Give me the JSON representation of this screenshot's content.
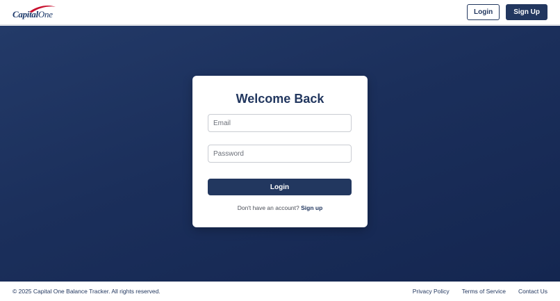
{
  "header": {
    "logo": {
      "brand": "Capital",
      "brand_suffix": "One"
    },
    "login_label": "Login",
    "signup_label": "Sign Up"
  },
  "colors": {
    "primary": "#22375f",
    "hero_top": "#233a68",
    "hero_bottom": "#142650",
    "logo_swoosh": "#c8102e"
  },
  "login_card": {
    "title": "Welcome Back",
    "email_placeholder": "Email",
    "password_placeholder": "Password",
    "submit_label": "Login",
    "signup_prompt": "Don't have an account?",
    "signup_link": "Sign up"
  },
  "footer": {
    "copyright": "© 2025 Capital One Balance Tracker. All rights reserved.",
    "links": [
      "Privacy Policy",
      "Terms of Service",
      "Contact Us"
    ]
  }
}
